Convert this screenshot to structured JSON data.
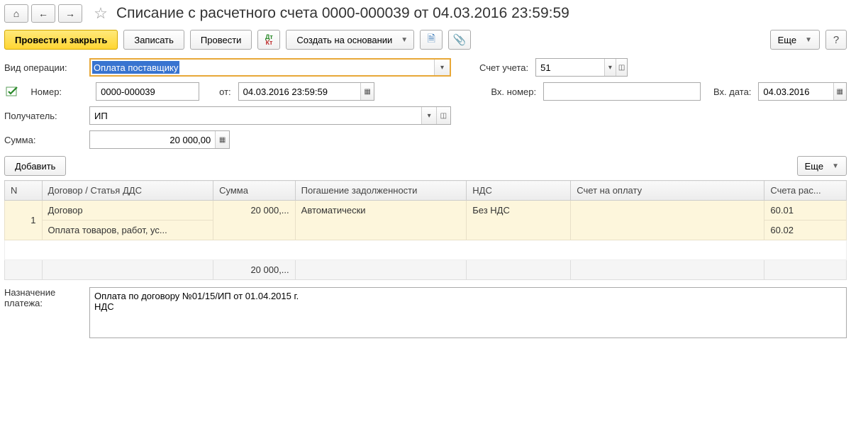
{
  "header": {
    "title": "Списание с расчетного счета 0000-000039 от 04.03.2016 23:59:59"
  },
  "toolbar": {
    "post_close": "Провести и закрыть",
    "save": "Записать",
    "post": "Провести",
    "create_based": "Создать на основании",
    "more": "Еще",
    "help": "?"
  },
  "form": {
    "operation_label": "Вид операции:",
    "operation_value": "Оплата поставщику",
    "account_label": "Счет учета:",
    "account_value": "51",
    "number_label": "Номер:",
    "number_value": "0000-000039",
    "date_label": "от:",
    "date_value": "04.03.2016 23:59:59",
    "in_number_label": "Вх. номер:",
    "in_number_value": "",
    "in_date_label": "Вх. дата:",
    "in_date_value": "04.03.2016",
    "recipient_label": "Получатель:",
    "recipient_value": "ИП",
    "sum_label": "Сумма:",
    "sum_value": "20 000,00"
  },
  "table": {
    "add": "Добавить",
    "more": "Еще",
    "headers": {
      "n": "N",
      "contract": "Договор / Статья ДДС",
      "sum": "Сумма",
      "repay": "Погашение задолженности",
      "vat": "НДС",
      "invoice": "Счет на оплату",
      "acc": "Счета рас..."
    },
    "rows": [
      {
        "n": "1",
        "contract_top": "Договор",
        "contract_bottom": "Оплата товаров, работ, ус...",
        "sum": "20 000,...",
        "repay": "Автоматически",
        "vat": "Без НДС",
        "invoice": "",
        "acc_top": "60.01",
        "acc_bottom": "60.02"
      }
    ],
    "total_sum": "20 000,..."
  },
  "payment": {
    "label": "Назначение платежа:",
    "text": "Оплата по договору №01/15/ИП от 01.04.2015 г.\nНДС"
  }
}
